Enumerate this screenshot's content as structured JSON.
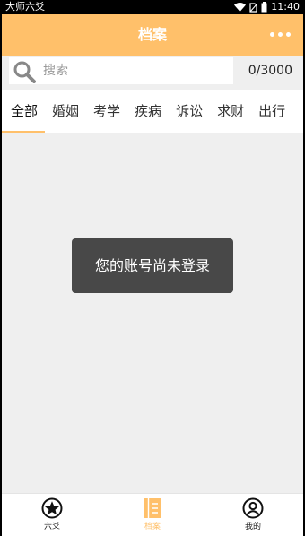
{
  "status_bar": {
    "app_name": "大师六爻",
    "time": "11:40"
  },
  "header": {
    "title": "档案",
    "more_icon": "more-dots-icon"
  },
  "search": {
    "placeholder": "搜索",
    "value": "",
    "counter": "0/3000"
  },
  "tabs": [
    {
      "label": "全部",
      "active": true
    },
    {
      "label": "婚姻",
      "active": false
    },
    {
      "label": "考学",
      "active": false
    },
    {
      "label": "疾病",
      "active": false
    },
    {
      "label": "诉讼",
      "active": false
    },
    {
      "label": "求财",
      "active": false
    },
    {
      "label": "出行",
      "active": false
    }
  ],
  "toast": {
    "message": "您的账号尚未登录"
  },
  "bottom_nav": [
    {
      "label": "六爻",
      "icon": "star-icon",
      "active": false
    },
    {
      "label": "档案",
      "icon": "archive-icon",
      "active": true
    },
    {
      "label": "我的",
      "icon": "user-icon",
      "active": false
    }
  ],
  "colors": {
    "accent": "#ffc06a",
    "background": "#efefef",
    "toast": "#484848"
  }
}
